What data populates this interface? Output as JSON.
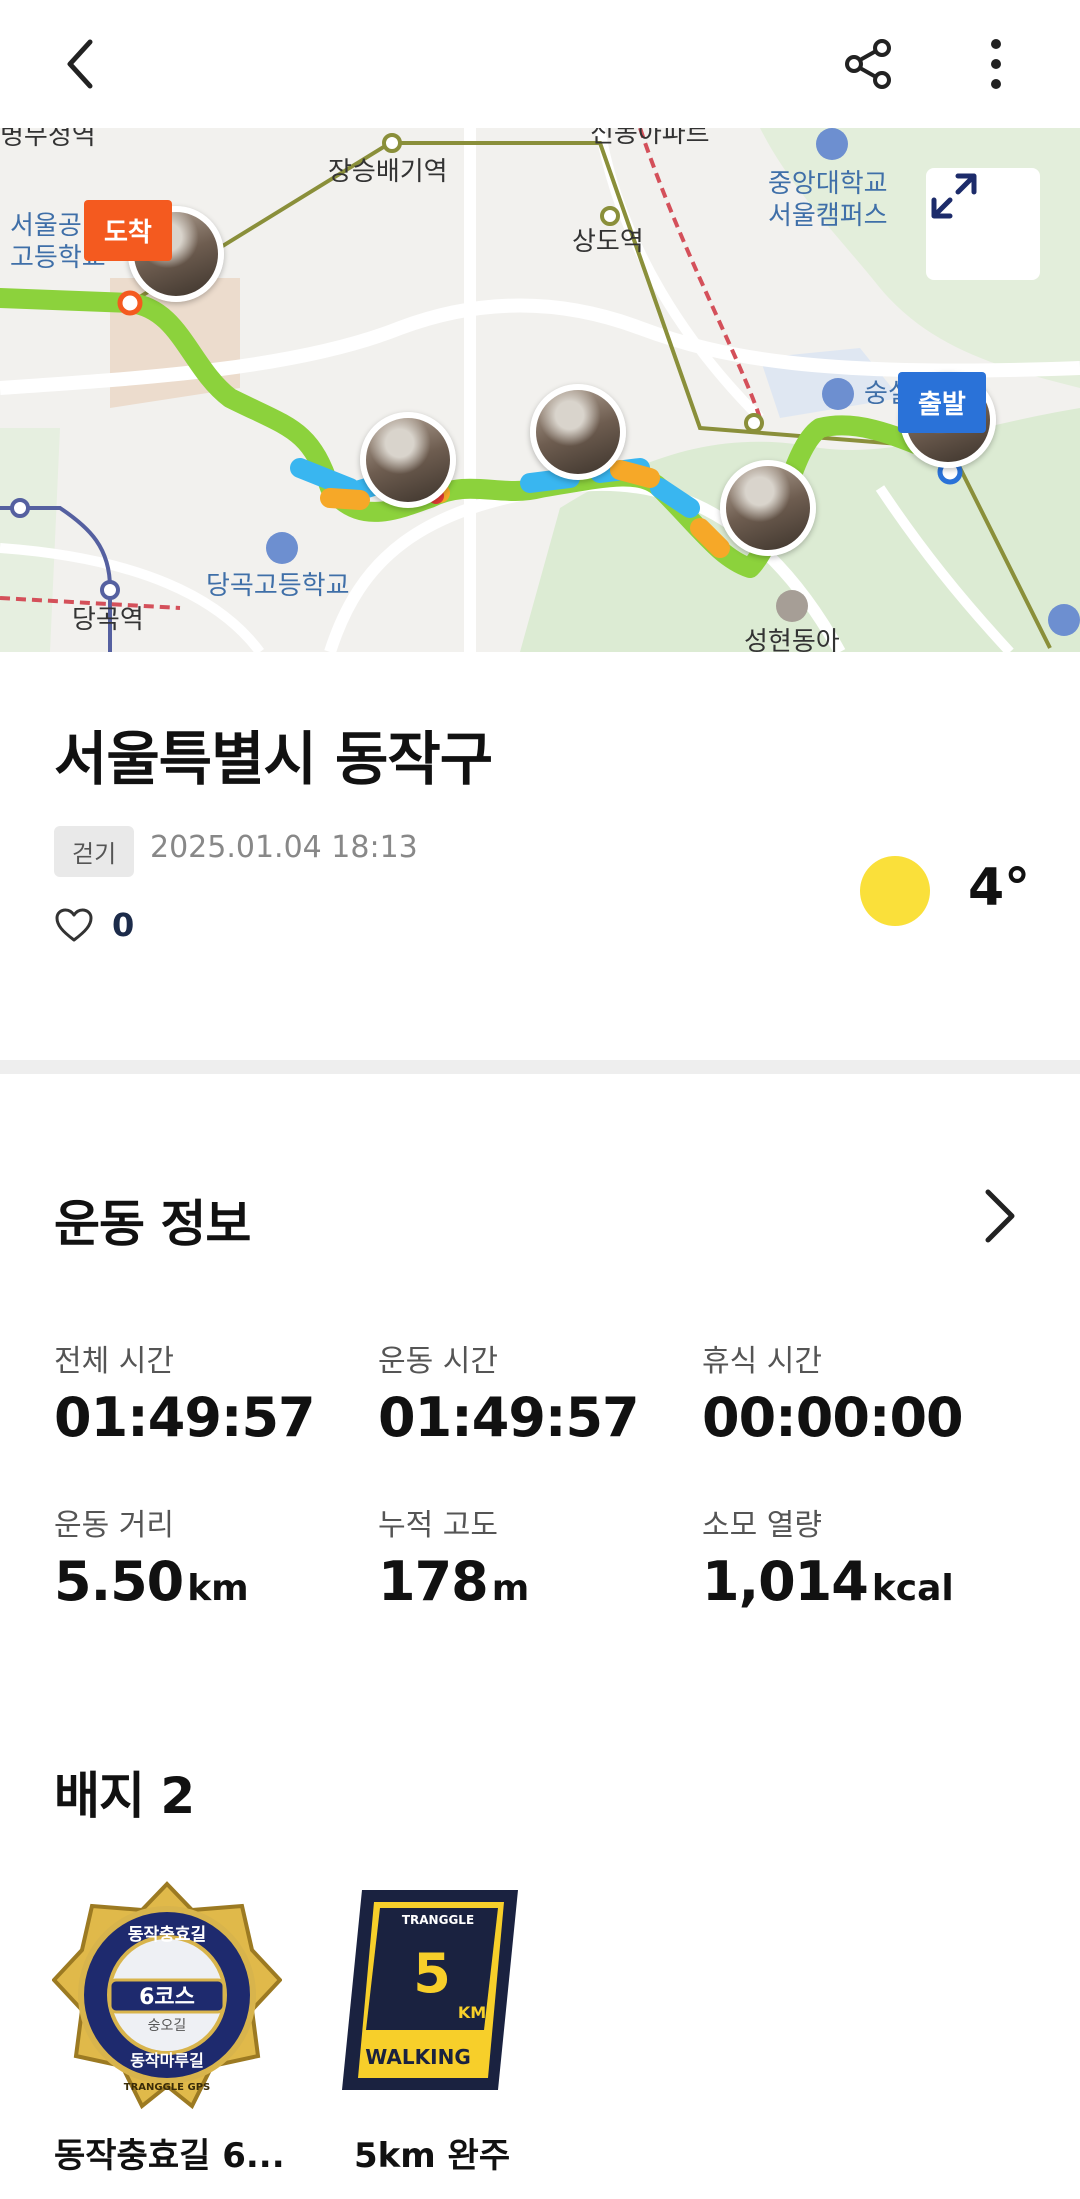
{
  "map": {
    "labels": [
      "병무청역",
      "장승배기역",
      "상도역",
      "중앙대학교",
      "서울캠퍼스",
      "서울공",
      "고등학교",
      "숭실",
      "당곡고등학교",
      "당곡역",
      "성현동아",
      "신동아파트"
    ],
    "pin_arrive": "도착",
    "pin_depart": "출발",
    "route_color": "#8cd23c"
  },
  "activity": {
    "title": "서울특별시 동작구",
    "tag": "걷기",
    "datetime": "2025.01.04 18:13",
    "likes": "0",
    "temperature": "4°",
    "weather_icon": "sun-icon"
  },
  "exercise": {
    "title": "운동 정보",
    "stats": [
      {
        "label": "전체 시간",
        "value": "01:49:57",
        "unit": ""
      },
      {
        "label": "운동 시간",
        "value": "01:49:57",
        "unit": ""
      },
      {
        "label": "휴식 시간",
        "value": "00:00:00",
        "unit": ""
      },
      {
        "label": "운동 거리",
        "value": "5.50",
        "unit": "km"
      },
      {
        "label": "누적 고도",
        "value": "178",
        "unit": "m"
      },
      {
        "label": "소모 열량",
        "value": "1,014",
        "unit": "kcal"
      }
    ]
  },
  "badges": {
    "title": "배지 2",
    "items": [
      {
        "name": "동작충효길 6...",
        "emblem_text_top": "동작충효길",
        "emblem_center": "6코스",
        "emblem_sub": "숭오길",
        "emblem_bottom": "동작마루길",
        "emblem_brand": "TRANGGLE GPS"
      },
      {
        "name": "5km 완주",
        "emblem_brand": "TRANGGLE",
        "emblem_number": "5",
        "emblem_unit": "KM",
        "emblem_text": "WALKING"
      }
    ]
  },
  "colors": {
    "accent_arrive": "#f45a1f",
    "accent_depart": "#2a72d8",
    "sun": "#fae03a"
  }
}
